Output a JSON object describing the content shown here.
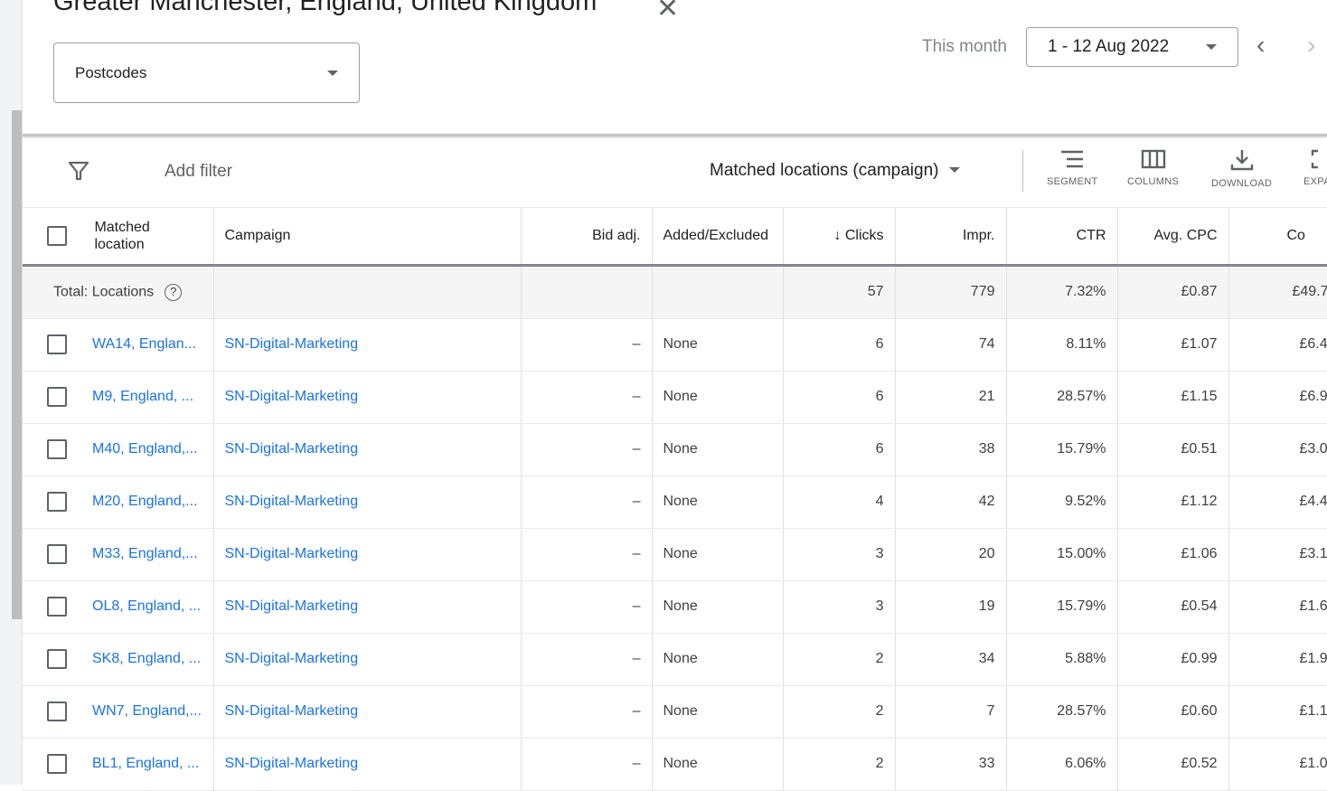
{
  "header": {
    "title": "Greater Manchester, England, United Kingdom",
    "close_icon": "close-icon",
    "location_type": "Postcodes",
    "date_label": "This month",
    "date_range": "1 - 12 Aug 2022"
  },
  "toolbar": {
    "add_filter": "Add filter",
    "view_select": "Matched locations (campaign)",
    "segment": "SEGMENT",
    "columns": "COLUMNS",
    "download": "DOWNLOAD",
    "expand": "EXPAND"
  },
  "colors": {
    "link": "#1a73e8",
    "text": "#3c4043"
  },
  "table": {
    "headers": {
      "location": "Matched location",
      "campaign": "Campaign",
      "bid_adj": "Bid adj.",
      "added_excluded": "Added/Excluded",
      "clicks": "Clicks",
      "impr": "Impr.",
      "ctr": "CTR",
      "avg_cpc": "Avg. CPC",
      "cost": "Co"
    },
    "sort": {
      "column": "Clicks",
      "direction": "descending"
    },
    "total": {
      "label": "Total: Locations",
      "clicks": "57",
      "impr": "779",
      "ctr": "7.32%",
      "avg_cpc": "£0.87",
      "cost": "£49.7"
    },
    "rows": [
      {
        "location": "WA14, Englan...",
        "campaign": "SN-Digital-Marketing",
        "bid_adj": "–",
        "added_excluded": "None",
        "clicks": "6",
        "impr": "74",
        "ctr": "8.11%",
        "avg_cpc": "£1.07",
        "cost": "£6.4"
      },
      {
        "location": "M9, England, ...",
        "campaign": "SN-Digital-Marketing",
        "bid_adj": "–",
        "added_excluded": "None",
        "clicks": "6",
        "impr": "21",
        "ctr": "28.57%",
        "avg_cpc": "£1.15",
        "cost": "£6.9"
      },
      {
        "location": "M40, England,...",
        "campaign": "SN-Digital-Marketing",
        "bid_adj": "–",
        "added_excluded": "None",
        "clicks": "6",
        "impr": "38",
        "ctr": "15.79%",
        "avg_cpc": "£0.51",
        "cost": "£3.0"
      },
      {
        "location": "M20, England,...",
        "campaign": "SN-Digital-Marketing",
        "bid_adj": "–",
        "added_excluded": "None",
        "clicks": "4",
        "impr": "42",
        "ctr": "9.52%",
        "avg_cpc": "£1.12",
        "cost": "£4.4"
      },
      {
        "location": "M33, England,...",
        "campaign": "SN-Digital-Marketing",
        "bid_adj": "–",
        "added_excluded": "None",
        "clicks": "3",
        "impr": "20",
        "ctr": "15.00%",
        "avg_cpc": "£1.06",
        "cost": "£3.1"
      },
      {
        "location": "OL8, England, ...",
        "campaign": "SN-Digital-Marketing",
        "bid_adj": "–",
        "added_excluded": "None",
        "clicks": "3",
        "impr": "19",
        "ctr": "15.79%",
        "avg_cpc": "£0.54",
        "cost": "£1.6"
      },
      {
        "location": "SK8, England, ...",
        "campaign": "SN-Digital-Marketing",
        "bid_adj": "–",
        "added_excluded": "None",
        "clicks": "2",
        "impr": "34",
        "ctr": "5.88%",
        "avg_cpc": "£0.99",
        "cost": "£1.9"
      },
      {
        "location": "WN7, England,...",
        "campaign": "SN-Digital-Marketing",
        "bid_adj": "–",
        "added_excluded": "None",
        "clicks": "2",
        "impr": "7",
        "ctr": "28.57%",
        "avg_cpc": "£0.60",
        "cost": "£1.1"
      },
      {
        "location": "BL1, England, ...",
        "campaign": "SN-Digital-Marketing",
        "bid_adj": "–",
        "added_excluded": "None",
        "clicks": "2",
        "impr": "33",
        "ctr": "6.06%",
        "avg_cpc": "£0.52",
        "cost": "£1.0"
      }
    ]
  }
}
